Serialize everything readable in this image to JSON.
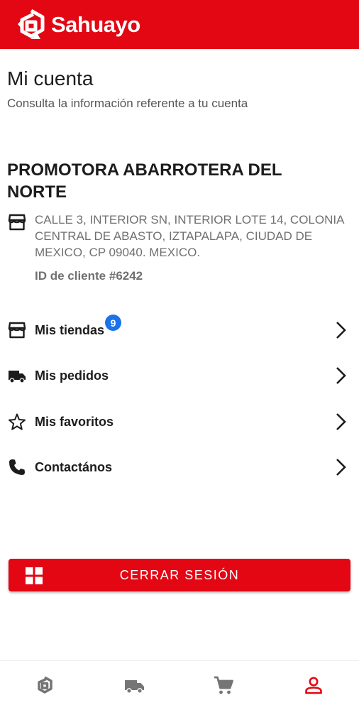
{
  "header": {
    "brand": "Sahuayo",
    "brand_color": "#e30613"
  },
  "page": {
    "title": "Mi cuenta",
    "subtitle": "Consulta la información referente a tu cuenta"
  },
  "account": {
    "company": "PROMOTORA ABARROTERA DEL NORTE",
    "address": "CALLE 3, INTERIOR SN, INTERIOR LOTE 14, COLONIA CENTRAL DE ABASTO, IZTAPALAPA, CIUDAD DE MEXICO, CP 09040. MEXICO.",
    "client_id": "ID de cliente #6242",
    "address_icon": "store-icon"
  },
  "menu": [
    {
      "label": "Mis tiendas",
      "icon": "store-icon",
      "badge": "9"
    },
    {
      "label": "Mis pedidos",
      "icon": "truck-icon"
    },
    {
      "label": "Mis favoritos",
      "icon": "star-icon"
    },
    {
      "label": "Contactános",
      "icon": "phone-icon"
    }
  ],
  "logout": {
    "label": "CERRAR SESIÓN",
    "icon": "grid-icon"
  },
  "bottom_nav": [
    {
      "icon": "home-logo-icon",
      "active": false
    },
    {
      "icon": "truck-icon",
      "active": false
    },
    {
      "icon": "cart-icon",
      "active": false
    },
    {
      "icon": "user-icon",
      "active": true
    }
  ],
  "colors": {
    "accent": "#e30613",
    "badge": "#1a73e8",
    "nav_inactive": "#757575"
  }
}
